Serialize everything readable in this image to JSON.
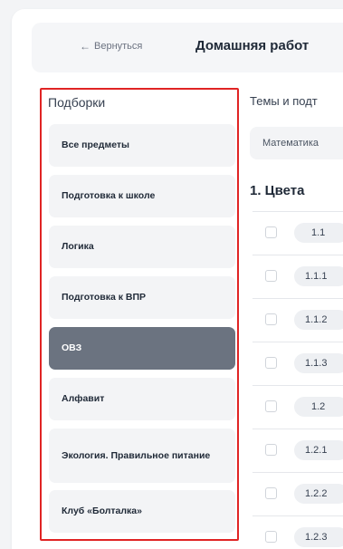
{
  "header": {
    "back_label": "Вернуться",
    "back_icon": "arrow-left-icon",
    "title": "Домашняя работ"
  },
  "sidebar": {
    "title": "Подборки",
    "items": [
      {
        "label": "Все предметы",
        "active": false
      },
      {
        "label": "Подготовка к школе",
        "active": false
      },
      {
        "label": "Логика",
        "active": false
      },
      {
        "label": "Подготовка к ВПР",
        "active": false
      },
      {
        "label": "ОВЗ",
        "active": true
      },
      {
        "label": "Алфавит",
        "active": false
      },
      {
        "label": "Экология. Правильное питание",
        "active": false
      },
      {
        "label": "Клуб «Болталка»",
        "active": false
      }
    ]
  },
  "main": {
    "topics_label": "Темы и подт",
    "subject_select": "Математика",
    "section_title": "1. Цвета",
    "topics": [
      {
        "number": "1.1"
      },
      {
        "number": "1.1.1"
      },
      {
        "number": "1.1.2"
      },
      {
        "number": "1.1.3"
      },
      {
        "number": "1.2"
      },
      {
        "number": "1.2.1"
      },
      {
        "number": "1.2.2"
      },
      {
        "number": "1.2.3"
      }
    ]
  },
  "colors": {
    "highlight_border": "#e02424",
    "active_item_bg": "#6b7380"
  }
}
